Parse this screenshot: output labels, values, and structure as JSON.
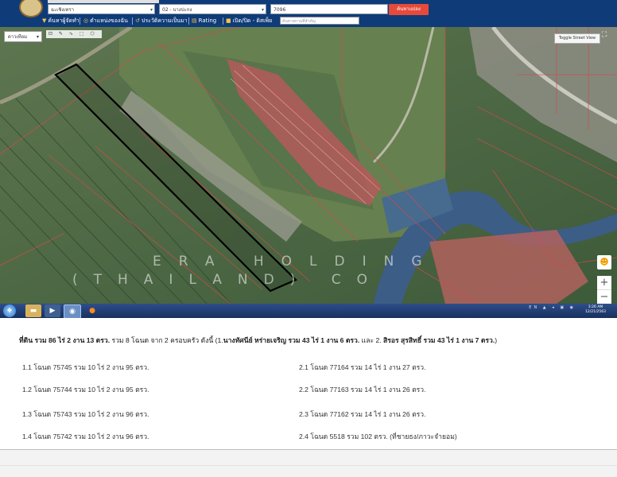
{
  "toolbar": {
    "province_select": "ฉะเชิงเทรา",
    "district_select": "02 - บางปะกง",
    "search_value": "7096",
    "search_button": "ค้นหาแปลง",
    "menu": [
      {
        "icon": "funnel-icon",
        "label": "ค้นหาผู้จัดทำ"
      },
      {
        "icon": "location-icon",
        "label": "ตำแหน่งของฉัน"
      },
      {
        "icon": "history-icon",
        "label": "ประวัติความเป็นมา"
      },
      {
        "icon": "rating-icon",
        "label": "Rating"
      },
      {
        "icon": "toggle-icon",
        "label": "เปิด/ปิด - ดิสเพ็ย"
      }
    ],
    "menu_input_placeholder": "ค้นหาสถานที่สำคัญ"
  },
  "map": {
    "layer_select": "ดาวเทียม",
    "tools_icons": "⊡ ✎ ∿ ⬚ ⬡",
    "streetview_label": "Toggle Street View",
    "watermark_line1": "ERA HOLDING",
    "watermark_line2": "(THAILAND) CO",
    "colors": {
      "parcel_outline": "#d24a4a",
      "highlight_outline": "#000000",
      "field_dark": "#3e5c3a",
      "field_light": "#6f8a5c",
      "water": "#3c5d86",
      "housing": "#b45a5a"
    }
  },
  "taskbar": {
    "tray_text": "EN ▲ ◂ ▣ ◉",
    "clock_time": "3:26 AM",
    "clock_date": "12/21/2563"
  },
  "panel": {
    "summary_lead": "ที่ดิน รวม 86 ไร่ 2 งาน 13 ตรว.",
    "summary_mid": " รวม 8 โฉนด จาก 2 ครอบครัว ดังนี้ (1.",
    "owner1": "นางทัศนีย์ หร่ายเจริญ รวม 43 ไร่ 1 งาน 6 ตรว.",
    "and": " และ 2. ",
    "owner2": "สิรอร สุรสิทธิ์ รวม 43 ไร่ 1 งาน 7 ตรว.",
    "close": ")",
    "left_rows": [
      "1.1 โฉนด 75745 รวม 10 ไร่ 2 งาน 95 ตรว.",
      "1.2 โฉนด 75744 รวม 10 ไร่ 2 งาน 95 ตรว.",
      "1.3 โฉนด 75743 รวม 10 ไร่ 2 งาน 96 ตรว.",
      "1.4 โฉนด 75742 รวม 10 ไร่ 2 งาน 96 ตรว."
    ],
    "right_rows": [
      "2.1 โฉนด 77164 รวม 14 ไร่ 1 งาน 27 ตรว.",
      "2.2 โฉนด 77163 รวม 14 ไร่ 1 งาน 26 ตรว.",
      "2.3 โฉนด 77162 รวม 14 ไร่ 1 งาน 26 ตรว.",
      "2.4 โฉนด 5518   รวม 102 ตรว. (ที่ชายธง/ภาวะจำยอม)"
    ]
  }
}
